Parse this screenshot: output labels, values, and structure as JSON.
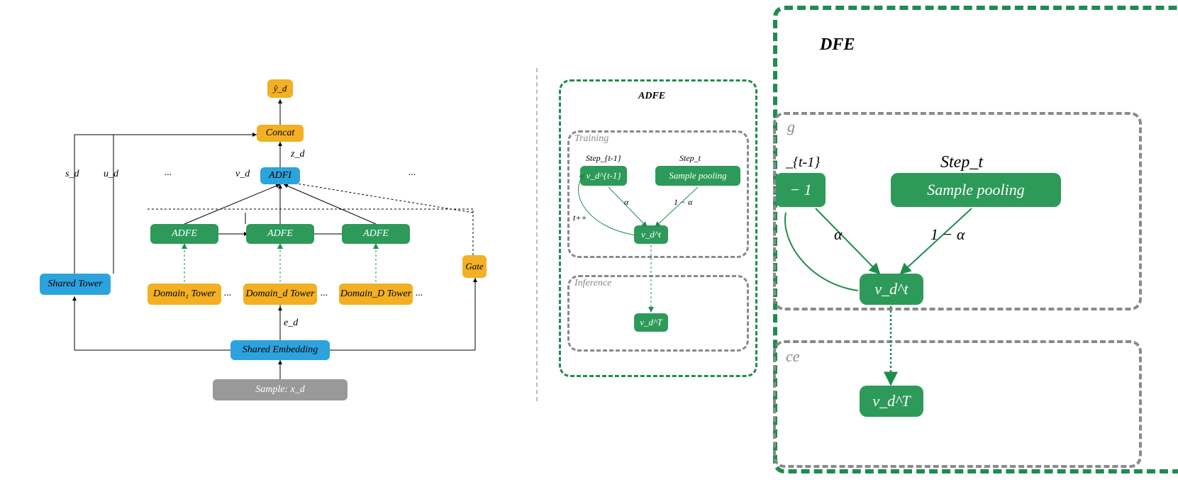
{
  "left": {
    "y_hat": "ŷ_d",
    "concat": "Concat",
    "zd": "z_d",
    "adfi": "ADFI",
    "sd": "s_d",
    "ud": "u_d",
    "vd": "v_d",
    "ellipsis": "...",
    "adfe": "ADFE",
    "gate": "Gate",
    "shared_tower": "Shared Tower",
    "domain1": "Domain₁ Tower",
    "domaind": "Domain_d Tower",
    "domainD": "Domain_D Tower",
    "ed": "e_d",
    "shared_emb": "Shared Embedding",
    "sample": "Sample: x_d"
  },
  "mid": {
    "title": "ADFE",
    "training": "Training",
    "inference": "Inference",
    "step_prev": "Step_{t-1}",
    "step_t": "Step_t",
    "v_prev": "v_d^{t-1}",
    "sample_pool": "Sample  pooling",
    "alpha": "α",
    "oneminus": "1 − α",
    "tpp": "t++",
    "v_t": "v_d^t",
    "v_T": "v_d^T"
  },
  "right": {
    "title": "DFE",
    "step_t": "Step_t",
    "sample_pool": "Sample  pooling",
    "alpha": "α",
    "oneminus": "1 − α",
    "v_t": "v_d^t",
    "v_T": "v_d^T",
    "g": "g",
    "t1": "_{t-1}",
    "minus1": "− 1",
    "ce": "ce"
  }
}
